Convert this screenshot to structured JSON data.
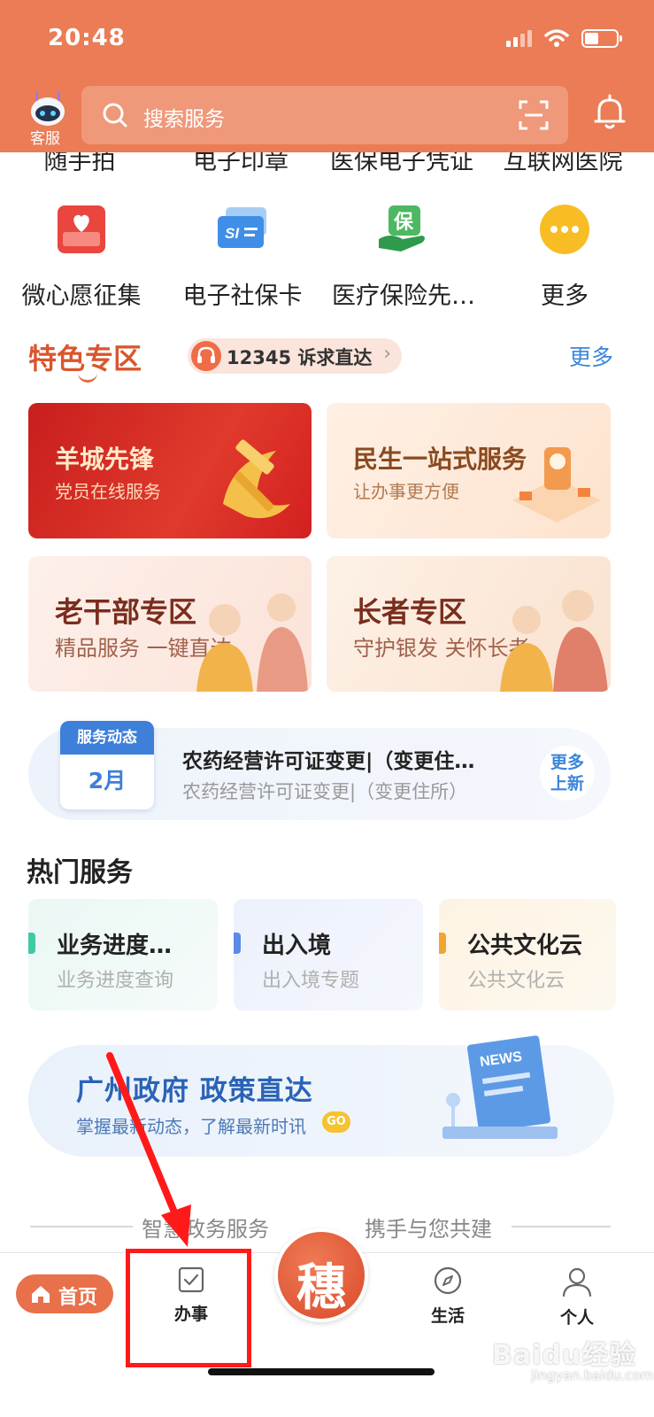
{
  "status_bar": {
    "time": "20:48"
  },
  "header": {
    "support_label": "客服",
    "search_placeholder": "搜索服务"
  },
  "quick_services_top": [
    "随手拍",
    "电子印章",
    "医保电子凭证",
    "互联网医院"
  ],
  "quick_services": [
    {
      "label": "微心愿征集",
      "icon": "heart-envelope-icon"
    },
    {
      "label": "电子社保卡",
      "icon": "social-security-card-icon",
      "badge": "SI"
    },
    {
      "label": "医疗保险先…",
      "icon": "insurance-hand-icon",
      "badge": "保"
    },
    {
      "label": "更多",
      "icon": "more-dots-icon"
    }
  ],
  "feature_zone": {
    "title": "特色专区",
    "hotline": "12345 诉求直达",
    "more": "更多",
    "cards": [
      {
        "title": "羊城先锋",
        "subtitle": "党员在线服务",
        "color": "#d42626"
      },
      {
        "title": "民生一站式服务",
        "subtitle": "让办事更方便",
        "color": "#8a4a20"
      },
      {
        "title": "老干部专区",
        "subtitle": "精品服务 一键直达",
        "color": "#7a2d1e"
      },
      {
        "title": "长者专区",
        "subtitle": "守护银发 关怀长者",
        "color": "#7a2d1e"
      }
    ]
  },
  "service_news": {
    "calendar_label": "服务动态",
    "month": "2月",
    "title": "农药经营许可证变更|（变更住…",
    "subtitle": "农药经营许可证变更|（变更住所）",
    "more_line1": "更多",
    "more_line2": "上新"
  },
  "hot_services": {
    "title": "热门服务",
    "items": [
      {
        "title": "业务进度…",
        "subtitle": "业务进度查询",
        "accent": "#3fcaa5"
      },
      {
        "title": "出入境",
        "subtitle": "出入境专题",
        "accent": "#5b8be6"
      },
      {
        "title": "公共文化云",
        "subtitle": "公共文化云",
        "accent": "#f0a531"
      }
    ]
  },
  "policy_banner": {
    "title": "广州政府 政策直达",
    "subtitle": "掌握最新动态，了解最新时讯",
    "badge": "GO",
    "board_text": "NEWS"
  },
  "slogan": {
    "left": "智慧政务服务",
    "right": "携手与您共建"
  },
  "tabbar": {
    "home": "首页",
    "work": "办事",
    "center_glyph": "穗",
    "life": "生活",
    "me": "个人"
  },
  "watermark": {
    "main": "Baidu经验",
    "sub": "jingyan.baidu.com"
  },
  "colors": {
    "header": "#eb7c55",
    "accent_red": "#d9562e",
    "link_blue": "#3b86d9",
    "highlight": "#ff1a1a"
  }
}
